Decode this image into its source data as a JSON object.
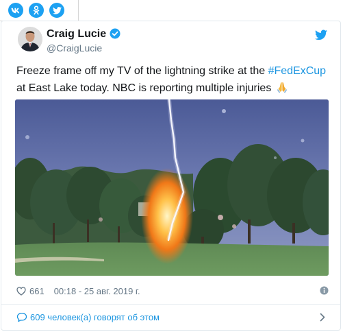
{
  "share": {
    "buttons": [
      "vk-icon",
      "odnoklassniki-icon",
      "twitter-icon"
    ]
  },
  "tweet": {
    "author": {
      "name": "Craig Lucie",
      "handle": "@CraigLucie",
      "verified": true
    },
    "text": {
      "part1": "Freeze frame off my TV of the lightning strike at the ",
      "hashtag": "#FedExCup",
      "part2": " at East Lake today. NBC is reporting multiple injuries"
    },
    "likes": "661",
    "timestamp": "00:18 - 25 авг. 2019 г.",
    "discussion": "609 человек(а) говорят об этом"
  },
  "colors": {
    "accent": "#1da1f2",
    "link": "#1b95e0",
    "muted": "#657786"
  }
}
